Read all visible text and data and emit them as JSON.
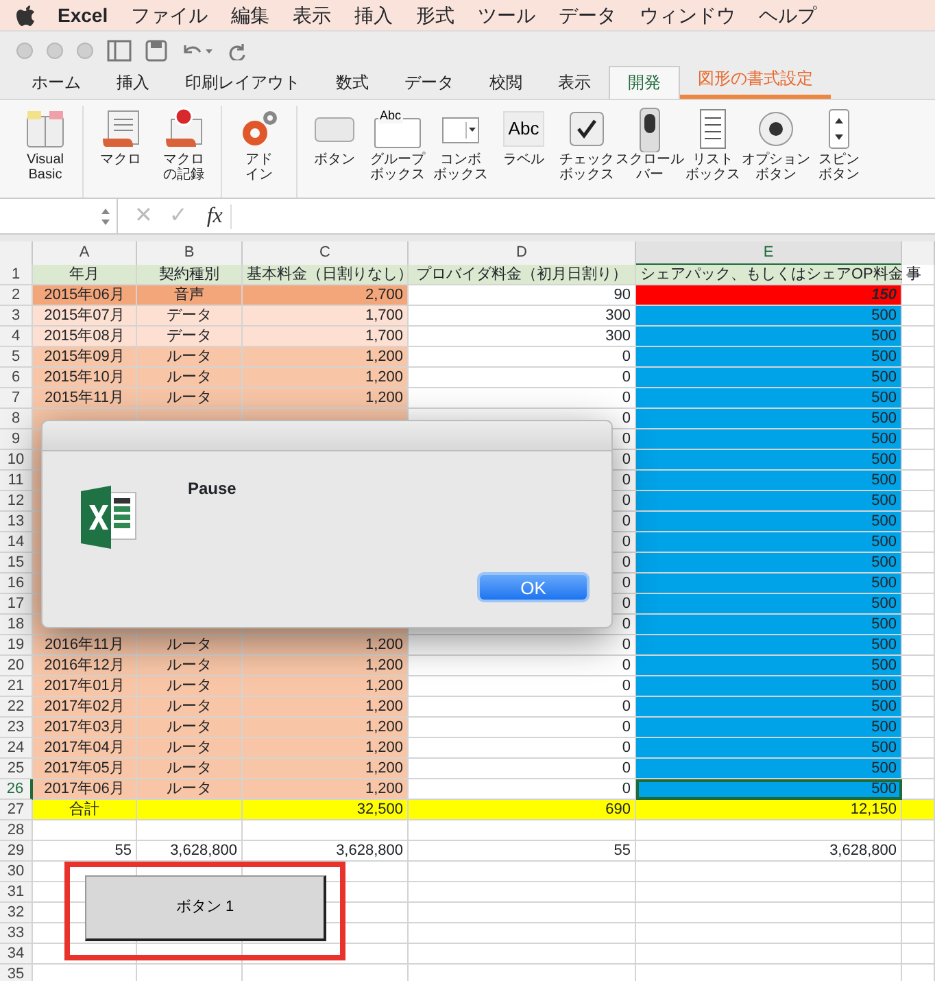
{
  "menu_bar": {
    "app": "Excel",
    "items": [
      "ファイル",
      "編集",
      "表示",
      "挿入",
      "形式",
      "ツール",
      "データ",
      "ウィンドウ",
      "ヘルプ"
    ]
  },
  "ribbon": {
    "tabs": [
      {
        "label": "ホーム",
        "selected": false,
        "kind": "normal"
      },
      {
        "label": "挿入",
        "selected": false,
        "kind": "normal"
      },
      {
        "label": "印刷レイアウト",
        "selected": false,
        "kind": "normal"
      },
      {
        "label": "数式",
        "selected": false,
        "kind": "normal"
      },
      {
        "label": "データ",
        "selected": false,
        "kind": "normal"
      },
      {
        "label": "校閲",
        "selected": false,
        "kind": "normal"
      },
      {
        "label": "表示",
        "selected": false,
        "kind": "normal"
      },
      {
        "label": "開発",
        "selected": true,
        "kind": "normal"
      },
      {
        "label": "図形の書式設定",
        "selected": false,
        "kind": "contextual"
      }
    ],
    "groups": [
      {
        "items": [
          {
            "kind": "vba",
            "lines": [
              "Visual",
              "Basic"
            ]
          }
        ]
      },
      {
        "items": [
          {
            "kind": "macro",
            "lines": [
              "マクロ"
            ]
          },
          {
            "kind": "record",
            "lines": [
              "マクロ",
              "の記録"
            ]
          }
        ]
      },
      {
        "items": [
          {
            "kind": "addin",
            "lines": [
              "アド",
              "イン"
            ]
          }
        ]
      },
      {
        "items": [
          {
            "kind": "button",
            "lines": [
              "ボタン"
            ]
          },
          {
            "kind": "groupbox",
            "icon_text": "Abc",
            "lines": [
              "グループ",
              "ボックス"
            ]
          },
          {
            "kind": "combobox",
            "lines": [
              "コンボ",
              "ボックス"
            ]
          },
          {
            "kind": "label",
            "icon_text": "Abc",
            "lines": [
              "ラベル"
            ]
          },
          {
            "kind": "checkbox",
            "lines": [
              "チェック",
              "ボックス"
            ]
          },
          {
            "kind": "scrollbar",
            "lines": [
              "スクロール",
              "バー"
            ]
          },
          {
            "kind": "listbox",
            "lines": [
              "リスト",
              "ボックス"
            ]
          },
          {
            "kind": "option",
            "lines": [
              "オプション",
              "ボタン"
            ]
          },
          {
            "kind": "spin",
            "lines": [
              "スピン",
              "ボタン"
            ]
          }
        ]
      }
    ]
  },
  "formula_bar": {
    "cancel": "✕",
    "enter": "✓",
    "fx": "fx"
  },
  "sheet": {
    "columns": [
      "A",
      "B",
      "C",
      "D",
      "E"
    ],
    "rows": [
      {
        "num": "1",
        "kind": "header",
        "selected": false,
        "a": "年月",
        "b": "契約種別",
        "c": "基本料金（日割りなし）",
        "d": "プロバイダ料金（初月日割り）",
        "e": "シェアパック、もしくはシェアOP料金",
        "f": "事"
      },
      {
        "num": "2",
        "kind": "voice",
        "selected": false,
        "a": "2015年06月",
        "b": "音声",
        "c": "2,700",
        "d": "90",
        "e": "150"
      },
      {
        "num": "3",
        "kind": "data",
        "selected": false,
        "a": "2015年07月",
        "b": "データ",
        "c": "1,700",
        "d": "300",
        "e": "500"
      },
      {
        "num": "4",
        "kind": "data",
        "selected": false,
        "a": "2015年08月",
        "b": "データ",
        "c": "1,700",
        "d": "300",
        "e": "500"
      },
      {
        "num": "5",
        "kind": "router",
        "selected": false,
        "a": "2015年09月",
        "b": "ルータ",
        "c": "1,200",
        "d": "0",
        "e": "500"
      },
      {
        "num": "6",
        "kind": "router",
        "selected": false,
        "a": "2015年10月",
        "b": "ルータ",
        "c": "1,200",
        "d": "0",
        "e": "500"
      },
      {
        "num": "7",
        "kind": "router",
        "selected": false,
        "a": "2015年11月",
        "b": "ルータ",
        "c": "1,200",
        "d": "0",
        "e": "500"
      },
      {
        "num": "8",
        "kind": "router",
        "selected": false,
        "d": "0",
        "e": "500"
      },
      {
        "num": "9",
        "kind": "router",
        "selected": false,
        "d": "0",
        "e": "500"
      },
      {
        "num": "10",
        "kind": "router",
        "selected": false,
        "d": "0",
        "e": "500"
      },
      {
        "num": "11",
        "kind": "router",
        "selected": false,
        "d": "0",
        "e": "500"
      },
      {
        "num": "12",
        "kind": "router",
        "selected": false,
        "d": "0",
        "e": "500"
      },
      {
        "num": "13",
        "kind": "router",
        "selected": false,
        "d": "0",
        "e": "500"
      },
      {
        "num": "14",
        "kind": "router",
        "selected": false,
        "d": "0",
        "e": "500"
      },
      {
        "num": "15",
        "kind": "router",
        "selected": false,
        "d": "0",
        "e": "500"
      },
      {
        "num": "16",
        "kind": "router",
        "selected": false,
        "d": "0",
        "e": "500"
      },
      {
        "num": "17",
        "kind": "router",
        "selected": false,
        "d": "0",
        "e": "500"
      },
      {
        "num": "18",
        "kind": "router",
        "selected": false,
        "d": "0",
        "e": "500"
      },
      {
        "num": "19",
        "kind": "router",
        "selected": false,
        "a": "2016年11月",
        "b": "ルータ",
        "c": "1,200",
        "d": "0",
        "e": "500"
      },
      {
        "num": "20",
        "kind": "router",
        "selected": false,
        "a": "2016年12月",
        "b": "ルータ",
        "c": "1,200",
        "d": "0",
        "e": "500"
      },
      {
        "num": "21",
        "kind": "router",
        "selected": false,
        "a": "2017年01月",
        "b": "ルータ",
        "c": "1,200",
        "d": "0",
        "e": "500"
      },
      {
        "num": "22",
        "kind": "router",
        "selected": false,
        "a": "2017年02月",
        "b": "ルータ",
        "c": "1,200",
        "d": "0",
        "e": "500"
      },
      {
        "num": "23",
        "kind": "router",
        "selected": false,
        "a": "2017年03月",
        "b": "ルータ",
        "c": "1,200",
        "d": "0",
        "e": "500"
      },
      {
        "num": "24",
        "kind": "router",
        "selected": false,
        "a": "2017年04月",
        "b": "ルータ",
        "c": "1,200",
        "d": "0",
        "e": "500"
      },
      {
        "num": "25",
        "kind": "router",
        "selected": false,
        "a": "2017年05月",
        "b": "ルータ",
        "c": "1,200",
        "d": "0",
        "e": "500"
      },
      {
        "num": "26",
        "kind": "router",
        "selected": true,
        "a": "2017年06月",
        "b": "ルータ",
        "c": "1,200",
        "d": "0",
        "e": "500"
      },
      {
        "num": "27",
        "kind": "total",
        "selected": false,
        "a": "合計",
        "c": "32,500",
        "d": "690",
        "e": "12,150"
      },
      {
        "num": "28",
        "kind": "plain",
        "selected": false
      },
      {
        "num": "29",
        "kind": "plain",
        "selected": false,
        "a": "55",
        "b": "3,628,800",
        "c": "3,628,800",
        "d": "55",
        "e": "3,628,800"
      },
      {
        "num": "30",
        "kind": "plain",
        "selected": false
      },
      {
        "num": "31",
        "kind": "plain",
        "selected": false
      },
      {
        "num": "32",
        "kind": "plain",
        "selected": false
      },
      {
        "num": "33",
        "kind": "plain",
        "selected": false
      },
      {
        "num": "34",
        "kind": "plain",
        "selected": false
      },
      {
        "num": "35",
        "kind": "plain",
        "selected": false
      }
    ]
  },
  "form_button": {
    "label": "ボタン 1",
    "selected": true
  },
  "dialog": {
    "message": "Pause",
    "button": "OK"
  }
}
